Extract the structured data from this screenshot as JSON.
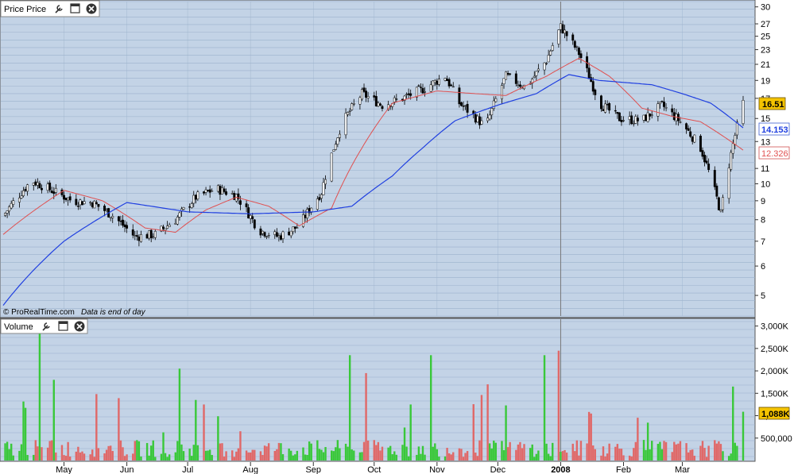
{
  "price_panel": {
    "title": "Price Price",
    "watermark": "© ProRealTime.com",
    "watermark_note": "Data is end of day",
    "toolbar": {
      "wrench_icon": "wrench-icon",
      "window_icon": "window-icon",
      "close_icon": "close-icon"
    }
  },
  "volume_panel": {
    "title": "Volume",
    "toolbar": {
      "wrench_icon": "wrench-icon",
      "window_icon": "window-icon",
      "close_icon": "close-icon"
    }
  },
  "colors": {
    "background": "#c3d3e6",
    "grid": "#9cb2cc",
    "up_volume": "#39c839",
    "down_volume": "#e06868",
    "ma_short": "#e05050",
    "ma_long": "#2040e0",
    "last_price_badge": "#f5c400"
  },
  "chart_data": [
    {
      "type": "candlestick",
      "panel": "price",
      "y_scale": "log",
      "ylim": [
        4.4,
        31
      ],
      "y_ticks": [
        "30",
        "27",
        "25",
        "23",
        "21",
        "19",
        "17",
        "15",
        "13",
        "11",
        "10",
        "9",
        "8",
        "7",
        "6",
        "5"
      ],
      "x_tick_labels": [
        "May",
        "Jun",
        "Jul",
        "Aug",
        "Sep",
        "Oct",
        "Nov",
        "Dec",
        "2008",
        "Feb",
        "Mar"
      ],
      "x_range": [
        "2007-04-01",
        "2008-03-31"
      ],
      "event_line_label": "2008",
      "last_price": "16.51",
      "ma_short_last": "12.326",
      "ma_long_last": "14.153",
      "close_series": [
        {
          "date": "2007-04-01",
          "close": 8.2
        },
        {
          "date": "2007-04-15",
          "close": 10.2
        },
        {
          "date": "2007-04-25",
          "close": 9.6
        },
        {
          "date": "2007-05-05",
          "close": 9.0
        },
        {
          "date": "2007-05-15",
          "close": 8.9
        },
        {
          "date": "2007-05-25",
          "close": 8.2
        },
        {
          "date": "2007-06-05",
          "close": 7.2
        },
        {
          "date": "2007-06-15",
          "close": 7.3
        },
        {
          "date": "2007-06-25",
          "close": 8.0
        },
        {
          "date": "2007-07-05",
          "close": 9.2
        },
        {
          "date": "2007-07-15",
          "close": 9.7
        },
        {
          "date": "2007-07-25",
          "close": 9.3
        },
        {
          "date": "2007-08-05",
          "close": 7.5
        },
        {
          "date": "2007-08-15",
          "close": 7.2
        },
        {
          "date": "2007-08-25",
          "close": 7.7
        },
        {
          "date": "2007-09-05",
          "close": 9.5
        },
        {
          "date": "2007-09-15",
          "close": 14.5
        },
        {
          "date": "2007-09-25",
          "close": 17.5
        },
        {
          "date": "2007-10-05",
          "close": 16.3
        },
        {
          "date": "2007-10-15",
          "close": 17.0
        },
        {
          "date": "2007-10-25",
          "close": 18.0
        },
        {
          "date": "2007-11-05",
          "close": 19.5
        },
        {
          "date": "2007-11-12",
          "close": 16.5
        },
        {
          "date": "2007-11-25",
          "close": 14.2
        },
        {
          "date": "2007-12-05",
          "close": 19.5
        },
        {
          "date": "2007-12-15",
          "close": 18.2
        },
        {
          "date": "2007-12-25",
          "close": 21.5
        },
        {
          "date": "2008-01-01",
          "close": 26.5
        },
        {
          "date": "2008-01-10",
          "close": 22.5
        },
        {
          "date": "2008-01-20",
          "close": 16.5
        },
        {
          "date": "2008-01-30",
          "close": 15.0
        },
        {
          "date": "2008-02-10",
          "close": 14.8
        },
        {
          "date": "2008-02-20",
          "close": 16.3
        },
        {
          "date": "2008-03-01",
          "close": 14.5
        },
        {
          "date": "2008-03-10",
          "close": 12.5
        },
        {
          "date": "2008-03-20",
          "close": 8.3
        },
        {
          "date": "2008-03-31",
          "close": 16.51
        }
      ],
      "ma_short_series": [
        {
          "date": "2007-04-01",
          "value": 7.3
        },
        {
          "date": "2007-05-01",
          "value": 9.6
        },
        {
          "date": "2007-05-20",
          "value": 9.0
        },
        {
          "date": "2007-06-10",
          "value": 7.6
        },
        {
          "date": "2007-06-25",
          "value": 7.4
        },
        {
          "date": "2007-07-10",
          "value": 8.5
        },
        {
          "date": "2007-07-25",
          "value": 9.2
        },
        {
          "date": "2007-08-10",
          "value": 8.7
        },
        {
          "date": "2007-08-25",
          "value": 7.7
        },
        {
          "date": "2007-09-10",
          "value": 8.6
        },
        {
          "date": "2007-09-25",
          "value": 12.5
        },
        {
          "date": "2007-10-10",
          "value": 16.5
        },
        {
          "date": "2007-11-01",
          "value": 17.8
        },
        {
          "date": "2007-11-20",
          "value": 17.5
        },
        {
          "date": "2007-12-05",
          "value": 17.3
        },
        {
          "date": "2007-12-25",
          "value": 19.5
        },
        {
          "date": "2008-01-10",
          "value": 21.8
        },
        {
          "date": "2008-01-25",
          "value": 19.5
        },
        {
          "date": "2008-02-10",
          "value": 16.0
        },
        {
          "date": "2008-02-25",
          "value": 15.2
        },
        {
          "date": "2008-03-10",
          "value": 14.7
        },
        {
          "date": "2008-03-31",
          "value": 12.326
        }
      ],
      "ma_long_series": [
        {
          "date": "2007-04-01",
          "value": 4.7
        },
        {
          "date": "2007-05-01",
          "value": 7.0
        },
        {
          "date": "2007-06-01",
          "value": 8.9
        },
        {
          "date": "2007-07-01",
          "value": 8.4
        },
        {
          "date": "2007-08-01",
          "value": 8.3
        },
        {
          "date": "2007-09-01",
          "value": 8.4
        },
        {
          "date": "2007-09-20",
          "value": 8.7
        },
        {
          "date": "2007-10-10",
          "value": 10.5
        },
        {
          "date": "2007-10-25",
          "value": 12.5
        },
        {
          "date": "2007-11-10",
          "value": 14.8
        },
        {
          "date": "2007-12-01",
          "value": 16.3
        },
        {
          "date": "2007-12-20",
          "value": 17.5
        },
        {
          "date": "2008-01-05",
          "value": 19.7
        },
        {
          "date": "2008-01-20",
          "value": 19.0
        },
        {
          "date": "2008-02-15",
          "value": 18.5
        },
        {
          "date": "2008-03-01",
          "value": 17.5
        },
        {
          "date": "2008-03-15",
          "value": 16.5
        },
        {
          "date": "2008-03-31",
          "value": 14.153
        }
      ]
    },
    {
      "type": "bar",
      "panel": "volume",
      "ylim": [
        0,
        3100000
      ],
      "y_ticks": [
        "3,000K",
        "2,500K",
        "2,000K",
        "1,500K",
        "1,000K",
        "500,000"
      ],
      "last_volume": "1,088K",
      "spikes": [
        {
          "date": "2007-04-20",
          "volume": 2900000,
          "direction": "up"
        },
        {
          "date": "2007-04-27",
          "volume": 1800000,
          "direction": "up"
        },
        {
          "date": "2007-06-28",
          "volume": 2050000,
          "direction": "up"
        },
        {
          "date": "2007-07-10",
          "volume": 1250000,
          "direction": "down"
        },
        {
          "date": "2007-09-20",
          "volume": 2350000,
          "direction": "up"
        },
        {
          "date": "2007-09-28",
          "volume": 1950000,
          "direction": "down"
        },
        {
          "date": "2007-10-28",
          "volume": 2350000,
          "direction": "up"
        },
        {
          "date": "2007-11-25",
          "volume": 1700000,
          "direction": "down"
        },
        {
          "date": "2007-12-25",
          "volume": 2350000,
          "direction": "up"
        },
        {
          "date": "2008-01-01",
          "volume": 2450000,
          "direction": "down"
        },
        {
          "date": "2008-03-27",
          "volume": 1650000,
          "direction": "up"
        },
        {
          "date": "2008-03-31",
          "volume": 1088000,
          "direction": "up"
        }
      ]
    }
  ]
}
